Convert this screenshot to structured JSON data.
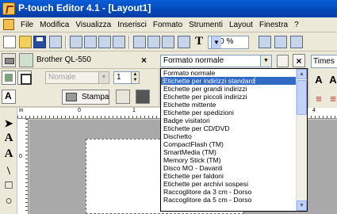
{
  "window": {
    "title": "P-touch Editor 4.1 - [Layout1]"
  },
  "menu": [
    "File",
    "Modifica",
    "Visualizza",
    "Inserisci",
    "Formato",
    "Strumenti",
    "Layout",
    "Finestra",
    "?"
  ],
  "toolbar": {
    "zoom": "100 %",
    "text_tool": "T"
  },
  "printer": {
    "name": "Brother QL-550",
    "close": "×"
  },
  "property": {
    "label_combo": "Nomale",
    "copies": "1",
    "print_label": "Stampa"
  },
  "format": {
    "selected": "Formato normale",
    "items": [
      "Formato normale",
      "Etichette per indirizzi standard",
      "Etichette per grandi indirizzi",
      "Etichette per piccoli indirizzi",
      "Etichette mittente",
      "Etichette per spedizioni",
      "Badge visitatori",
      "Etichette per CD/DVD",
      "Dischetto",
      "CompactFlash (TM)",
      "SmartMedia (TM)",
      "Memory Stick (TM)",
      "Disco MO - Davanti",
      "Etichette per faldoni",
      "Etichette per archivi sospesi",
      "Raccoglitore da 3 cm - Dorso",
      "Raccoglitore da 5 cm - Dorso"
    ],
    "highlighted_index": 1,
    "close": "×"
  },
  "font": {
    "name": "Times N"
  },
  "ruler": {
    "h_labels": [
      "in",
      "0",
      "1",
      "4"
    ],
    "v_labels": [
      "0"
    ]
  },
  "tools": [
    "A",
    "A",
    "\\",
    "□",
    "○"
  ]
}
